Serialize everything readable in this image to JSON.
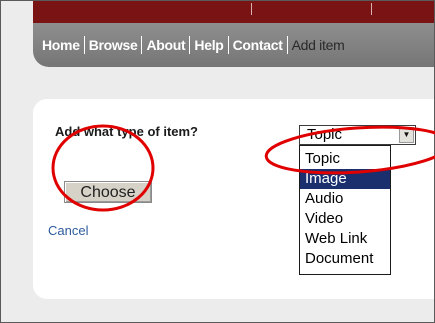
{
  "nav": {
    "items": [
      "Home",
      "Browse",
      "About",
      "Help",
      "Contact"
    ],
    "current": "Add item"
  },
  "form": {
    "question": "Add what type of item?",
    "choose_label": "Choose",
    "cancel_label": "Cancel"
  },
  "select": {
    "value": "Topic",
    "options": [
      "Topic",
      "Image",
      "Audio",
      "Video",
      "Web Link",
      "Document"
    ],
    "highlighted_option": "Image"
  },
  "colors": {
    "top_bar": "#7a1414",
    "nav_bar": "#808080",
    "link": "#2e5c9e",
    "option_highlight": "#1b2f6e",
    "annotation": "#e00000"
  }
}
